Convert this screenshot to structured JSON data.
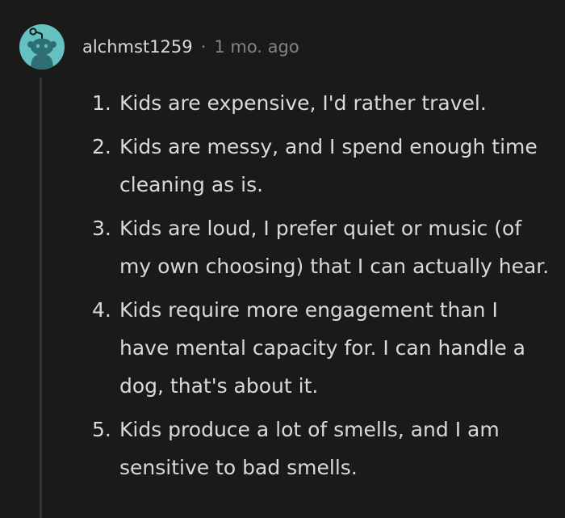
{
  "comment": {
    "username": "alchmst1259",
    "separator": "·",
    "timestamp": "1 mo. ago",
    "colors": {
      "background": "#1a1a1b",
      "text": "#d7dadc",
      "meta": "#818384",
      "avatar": "#64c3c0",
      "threadline": "#343536"
    },
    "avatar_icon": "reddit-snoo-avatar",
    "items": [
      {
        "number": "1.",
        "text": "Kids are expensive, I'd rather travel."
      },
      {
        "number": "2.",
        "text": "Kids are messy, and I spend enough time cleaning as is."
      },
      {
        "number": "3.",
        "text": "Kids are loud, I prefer quiet or music (of my own choosing) that I can actually hear."
      },
      {
        "number": "4.",
        "text": "Kids require more engagement than I have mental capacity for. I can handle a dog, that's about it."
      },
      {
        "number": "5.",
        "text": "Kids produce a lot of smells, and I am sensitive to bad smells."
      }
    ]
  }
}
